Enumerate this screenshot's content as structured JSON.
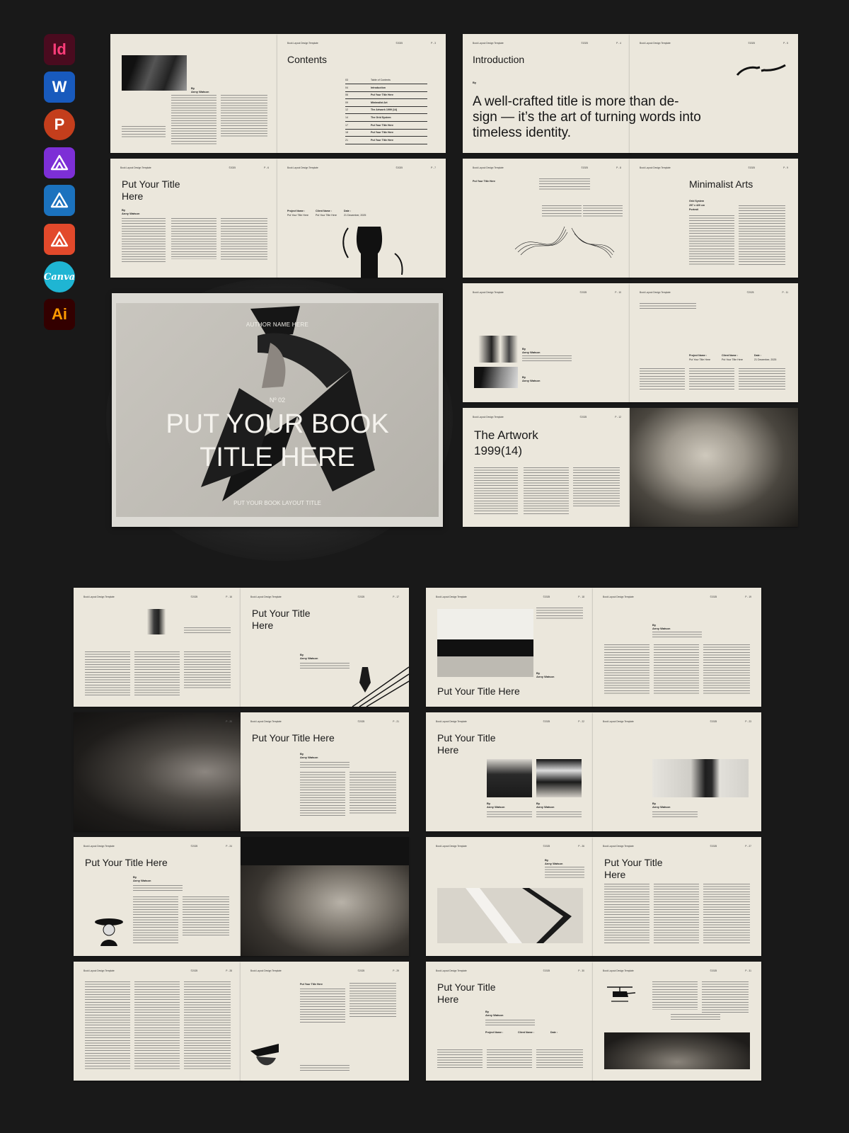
{
  "app_icons": [
    {
      "name": "indesign-icon",
      "label": "Id",
      "bg": "#4a0b1f",
      "fg": "#ff3d7a"
    },
    {
      "name": "word-icon",
      "label": "W",
      "bg": "#185abd",
      "fg": "#ffffff"
    },
    {
      "name": "powerpoint-icon",
      "label": "P",
      "bg": "#c43e1c",
      "fg": "#ffffff"
    },
    {
      "name": "affinity-publisher-icon",
      "label": "",
      "bg": "#7d2fd6",
      "fg": "#ffffff"
    },
    {
      "name": "affinity-designer-icon",
      "label": "",
      "bg": "#1b72be",
      "fg": "#ffffff"
    },
    {
      "name": "affinity-photo-icon",
      "label": "",
      "bg": "#e2492b",
      "fg": "#ffffff"
    },
    {
      "name": "canva-icon",
      "label": "Canva",
      "bg": "#1fb5d3",
      "fg": "#ffffff"
    },
    {
      "name": "illustrator-icon",
      "label": "Ai",
      "bg": "#330000",
      "fg": "#ff9a00"
    }
  ],
  "header": {
    "template": "Book Layout Design Template",
    "year": "©2025"
  },
  "pages": {
    "p2": {
      "no": "P - 2",
      "by": "By",
      "author": "Anny Watson"
    },
    "p3": {
      "no": "P - 3",
      "title": "Contents",
      "toc": [
        {
          "n": "03",
          "label": "Table of Contents"
        },
        {
          "n": "04",
          "label": "Introduction"
        },
        {
          "n": "06",
          "label": "Put Your Title Here"
        },
        {
          "n": "09",
          "label": "Minimalist Art"
        },
        {
          "n": "12",
          "label": "The Artwork 1999 (14)"
        },
        {
          "n": "14",
          "label": "The Grid System"
        },
        {
          "n": "17",
          "label": "Put Your Title Here"
        },
        {
          "n": "18",
          "label": "Put Your Title Here"
        },
        {
          "n": "21",
          "label": "Put Your Title Here"
        }
      ]
    },
    "p4": {
      "no": "P - 4",
      "title": "Introduction",
      "by": "By",
      "quote": "A well-crafted title is more than de-\nsign — it’s the art of turning words into\ntimeless identity."
    },
    "p5": {
      "no": "P - 5"
    },
    "p6": {
      "no": "P - 6",
      "title": "Put Your Title\nHere",
      "by": "By",
      "author": "Anny Watson"
    },
    "p7": {
      "no": "P - 7",
      "project_label": "Project Name :",
      "project_val": "Put Your Title Here",
      "client_label": "Client Name :",
      "client_val": "Put Your Title Here",
      "date_label": "Date :",
      "date_val": "21 December, 2025"
    },
    "p8": {
      "no": "P - 8",
      "title": "Put Your Title Here"
    },
    "p9": {
      "no": "P - 9",
      "title": "Minimalist Arts",
      "grid_label": "Grid System",
      "grid_size": "297 x 420 cm",
      "grid_orient": "Portrait"
    },
    "p10": {
      "no": "P - 10",
      "by": "By",
      "author": "Anny Watson"
    },
    "p11": {
      "no": "P - 11",
      "project_label": "Project Name :",
      "project_val": "Put Your Title Here",
      "client_label": "Client Name :",
      "client_val": "Put Your Title Here",
      "date_label": "Date :",
      "date_val": "21 December, 2025"
    },
    "p12": {
      "no": "P - 12",
      "title": "The Artwork\n1999(14)"
    },
    "p16": {
      "no": "P - 16"
    },
    "p17": {
      "no": "P - 17",
      "title": "Put Your Title\nHere",
      "by": "By",
      "author": "Anny Watson"
    },
    "p18": {
      "no": "P - 18",
      "title": "Put Your Title Here",
      "by": "By",
      "author": "Anny Watson"
    },
    "p19": {
      "no": "P - 19",
      "by": "By",
      "author": "Anny Watson"
    },
    "p20": {
      "no": "P - 20"
    },
    "p21": {
      "no": "P - 21",
      "title": "Put Your Title Here",
      "by": "By",
      "author": "Anny Watson"
    },
    "p22": {
      "no": "P - 22",
      "title": "Put Your Title\nHere",
      "by": "By",
      "author": "Anny Watson"
    },
    "p23": {
      "no": "P - 23",
      "by": "By",
      "author": "Anny Watson"
    },
    "p24": {
      "no": "P - 24",
      "title": "Put Your Title Here",
      "by": "By",
      "author": "Anny Watson"
    },
    "p25": {
      "no": "P - 25"
    },
    "p26": {
      "no": "P - 26",
      "by": "By",
      "author": "Anny Watson"
    },
    "p27": {
      "no": "P - 27",
      "title": "Put Your Title\nHere"
    },
    "p28": {
      "no": "P - 28"
    },
    "p29": {
      "no": "P - 29",
      "title": "Put Your Title Here"
    },
    "p30": {
      "no": "P - 30",
      "title": "Put Your Title\nHere",
      "by": "By",
      "author": "Anny Watson",
      "project_label": "Project Name :",
      "client_label": "Client Name :",
      "date_label": "Date :"
    },
    "p31": {
      "no": "P - 31"
    }
  },
  "cover": {
    "author": "AUTHOR NAME HERE",
    "number": "Nº 02",
    "title": "PUT YOUR BOOK\nTITLE HERE",
    "subtitle": "PUT YOUR BOOK LAYOUT TITLE"
  }
}
